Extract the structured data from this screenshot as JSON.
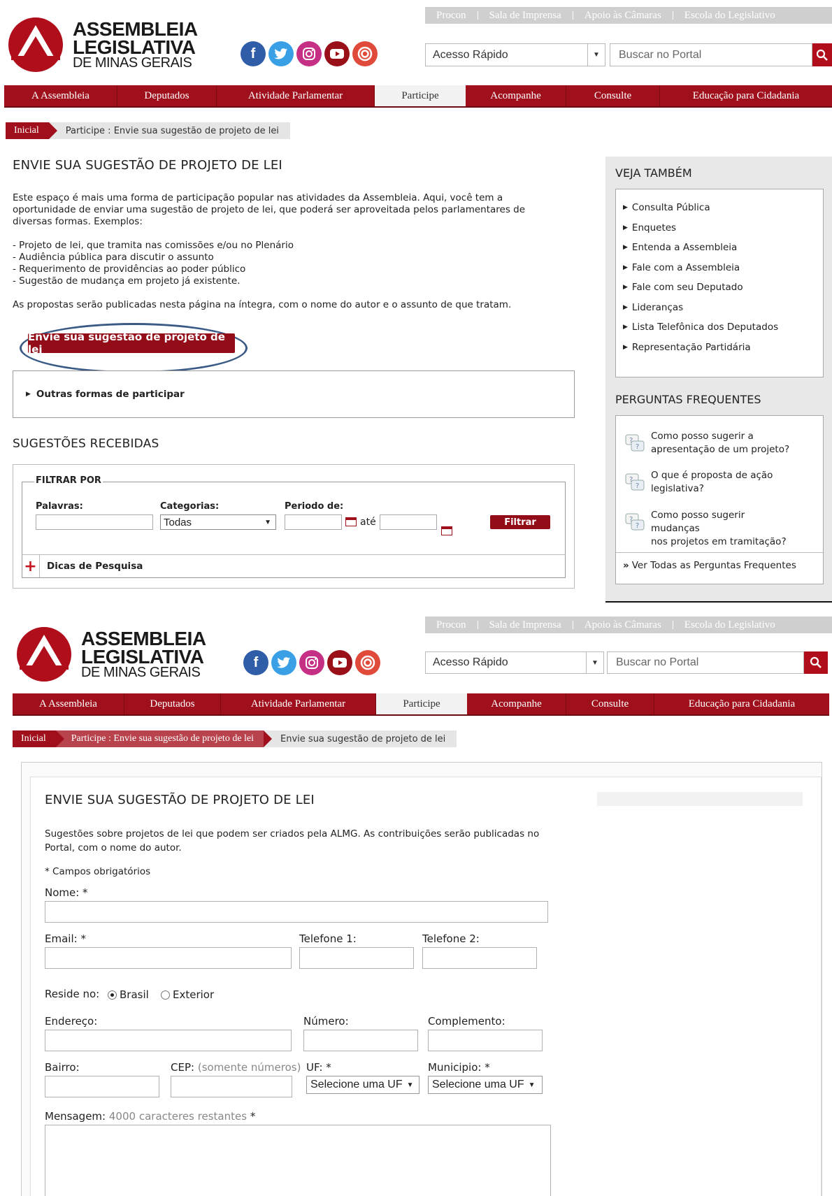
{
  "header": {
    "top_links": [
      "Procon",
      "Sala de Imprensa",
      "Apoio às Câmaras",
      "Escola do Legislativo"
    ],
    "logo": {
      "line1": "ASSEMBLEIA",
      "line2": "LEGISLATIVA",
      "line3": "DE MINAS GERAIS"
    },
    "social_icons": [
      "facebook-icon",
      "twitter-icon",
      "instagram-icon",
      "youtube-icon",
      "target-icon"
    ],
    "quick_access": "Acesso Rápido",
    "search_placeholder": "Buscar no Portal",
    "nav": [
      "A Assembleia",
      "Deputados",
      "Atividade Parlamentar",
      "Participe",
      "Acompanhe",
      "Consulte",
      "Educação para Cidadania"
    ],
    "active_nav": "Participe",
    "brand_color": "#a0101c"
  },
  "s1": {
    "breadcrumb": {
      "home": "Inicial",
      "current": "Participe : Envie sua sugestão de projeto de lei"
    },
    "title": "ENVIE SUA SUGESTÃO DE PROJETO DE LEI",
    "intro": [
      "Este espaço é mais uma forma de participação popular nas atividades da Assembleia. Aqui, você tem a",
      "oportunidade de enviar uma sugestão de projeto de lei, que poderá ser aproveitada pelos parlamentares de",
      "diversas formas. Exemplos:"
    ],
    "examples": [
      "- Projeto de lei, que tramita nas comissões e/ou no Plenário",
      "- Audiência pública para discutir o assunto",
      "- Requerimento de providências ao poder público",
      "- Sugestão de mudança em projeto já existente."
    ],
    "publish_note": "As propostas serão publicadas nesta página na íntegra, com o nome do autor e o assunto de que tratam.",
    "submit_button": "Envie sua sugestão de projeto de lei",
    "other_ways": "Outras formas de participar",
    "received_title": "SUGESTÕES RECEBIDAS",
    "filter": {
      "legend": "FILTRAR POR",
      "palavras": "Palavras:",
      "categorias": "Categorias:",
      "categoria_value": "Todas",
      "periodo": "Periodo de:",
      "ate": "até",
      "button": "Filtrar",
      "tips": "Dicas de Pesquisa"
    },
    "sidebar": {
      "veja_title": "VEJA TAMBÉM",
      "veja_items": [
        "Consulta Pública",
        "Enquetes",
        "Entenda a Assembleia",
        "Fale com a Assembleia",
        "Fale com seu Deputado",
        "Lideranças",
        "Lista Telefônica dos Deputados",
        "Representação Partidária"
      ],
      "faq_title": "PERGUNTAS FREQUENTES",
      "faq_items": [
        [
          "Como posso sugerir a",
          "apresentação de um projeto?"
        ],
        [
          "O que é proposta de ação",
          "legislativa?"
        ],
        [
          "Como posso sugerir mudanças",
          "nos projetos em tramitação?"
        ]
      ],
      "faq_all": "Ver Todas as Perguntas Frequentes"
    }
  },
  "s2": {
    "breadcrumb": {
      "home": "Inicial",
      "middle": "Participe : Envie sua sugestão de projeto de lei",
      "current": "Envie sua sugestão de projeto de lei"
    },
    "title": "ENVIE SUA SUGESTÃO DE PROJETO DE LEI",
    "desc": [
      "Sugestões sobre projetos de lei que podem ser criados pela ALMG. As contribuições serão publicadas no",
      "Portal, com o nome do autor."
    ],
    "required_note": "* Campos obrigatórios",
    "labels": {
      "nome": "Nome: *",
      "email": "Email: *",
      "tel1": "Telefone 1:",
      "tel2": "Telefone 2:",
      "reside": "Reside no:",
      "brasil": "Brasil",
      "exterior": "Exterior",
      "endereco": "Endereço:",
      "numero": "Número:",
      "complemento": "Complemento:",
      "bairro": "Bairro:",
      "cep": "CEP:",
      "cep_hint": "(somente números)",
      "uf": "UF: *",
      "municipio": "Municipio: *",
      "mensagem": "Mensagem:",
      "mensagem_hint": "4000 caracteres restantes",
      "mensagem_req": "*"
    },
    "uf_value": "Selecione uma UF",
    "municipio_value": "Selecione uma UF",
    "reside_selected": "Brasil"
  }
}
